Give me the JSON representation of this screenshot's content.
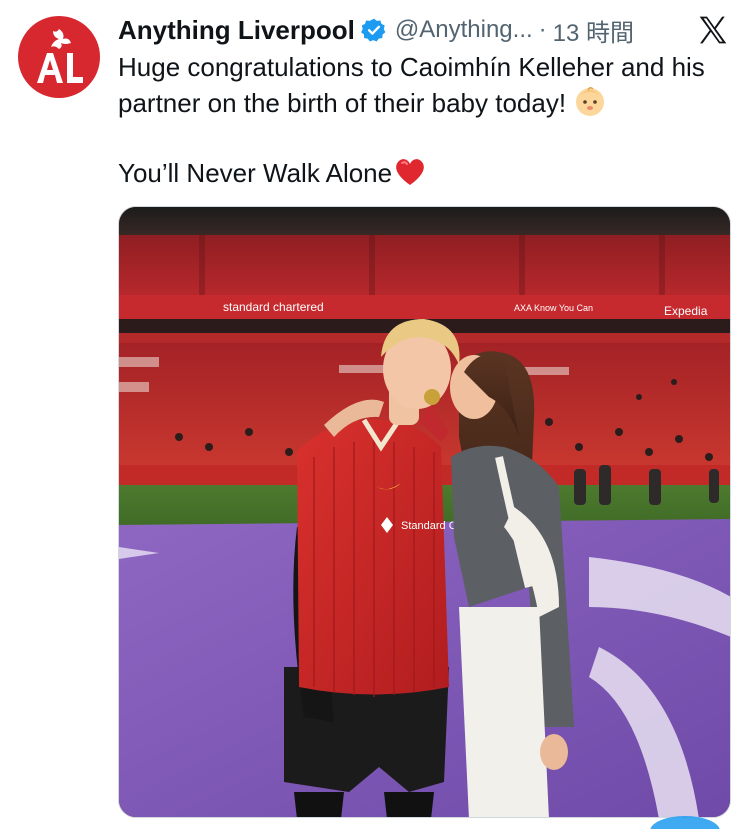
{
  "tweet": {
    "author_name": "Anything Liverpool",
    "author_handle": "@Anything...",
    "separator": "·",
    "timestamp": "13 時間",
    "text_line1": "Huge congratulations to Caoimhín Kelleher and his partner on the birth of their baby today!",
    "text_line2": "You’ll Never Walk Alone",
    "icons": {
      "avatar": "anything-liverpool-logo",
      "verified": "verified-badge-icon",
      "platform": "x-logo-icon",
      "baby": "baby-emoji",
      "heart": "red-heart-emoji"
    }
  },
  "photo": {
    "banner_sponsor_left": "standard chartered",
    "banner_sponsor_middle": "AXA  Know You Can",
    "banner_sponsor_right": "Expedia",
    "shirt_sponsor": "Standard Chartered"
  },
  "colors": {
    "brand_red": "#d7282f",
    "verified_blue": "#1d9bf0",
    "text": "#0f1419",
    "muted": "#536471"
  }
}
